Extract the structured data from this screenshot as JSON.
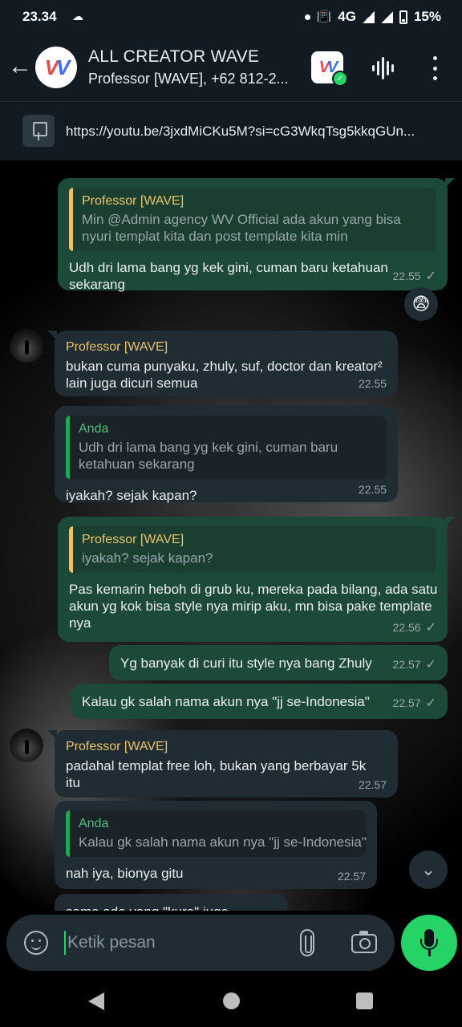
{
  "status_bar": {
    "time": "23.34",
    "network": "4G",
    "battery": "15%"
  },
  "header": {
    "title": "ALL CREATOR WAVE",
    "subtitle": "Professor [WAVE], +62 812-2..."
  },
  "pinned": {
    "text": "https://youtu.be/3jxdMiCKu5M?si=cG3WkqTsg5kkqGUn..."
  },
  "messages": [
    {
      "direction": "out",
      "quote_name": "Professor [WAVE]",
      "quote_text": "Min @Admin agency WV Official ada akun yang bisa nyuri templat kita dan post template kita min",
      "text": "Udh dri lama bang yg kek gini, cuman baru ketahuan sekarang",
      "time": "22.55",
      "reaction": "😨"
    },
    {
      "direction": "in",
      "sender": "Professor [WAVE]",
      "text": "bukan cuma punyaku, zhuly, suf, doctor dan kreator² lain juga dicuri semua",
      "time": "22.55"
    },
    {
      "direction": "in",
      "quote_name": "Anda",
      "quote_text": "Udh dri lama bang yg kek gini, cuman baru ketahuan sekarang",
      "text": "iyakah? sejak kapan?",
      "time": "22.55"
    },
    {
      "direction": "out",
      "quote_name": "Professor [WAVE]",
      "quote_text": "iyakah? sejak kapan?",
      "text": "Pas kemarin heboh di grub ku, mereka pada bilang, ada satu akun yg kok bisa style nya mirip aku, mn bisa pake template nya",
      "time": "22.56"
    },
    {
      "direction": "out",
      "text": "Yg banyak di curi itu style nya bang Zhuly",
      "time": "22.57"
    },
    {
      "direction": "out",
      "text": "Kalau gk salah nama akun nya \"jj se-Indonesia\"",
      "time": "22.57"
    },
    {
      "direction": "in",
      "sender": "Professor [WAVE]",
      "text": "padahal templat free loh, bukan yang berbayar 5k itu",
      "time": "22.57"
    },
    {
      "direction": "in",
      "quote_name": "Anda",
      "quote_text": "Kalau gk salah nama akun nya \"jj se-Indonesia\"",
      "text": "nah iya, bionya gitu",
      "time": "22.57"
    },
    {
      "direction": "in",
      "text": "sama ada yang \"kuro\" juga"
    }
  ],
  "input": {
    "placeholder": "Ketik pesan"
  },
  "colors": {
    "accent_green": "#25d366",
    "outgoing_bubble": "#1d4a38",
    "incoming_bubble": "#202c33",
    "quote_yellow": "#e9c46a",
    "quote_green": "#1fa855"
  },
  "icons": [
    "back-arrow-icon",
    "group-avatar",
    "app-badge-icon",
    "voice-wave-icon",
    "more-vert-icon",
    "pin-icon",
    "emoji-icon",
    "attach-icon",
    "camera-icon",
    "mic-icon",
    "scroll-down-icon"
  ]
}
